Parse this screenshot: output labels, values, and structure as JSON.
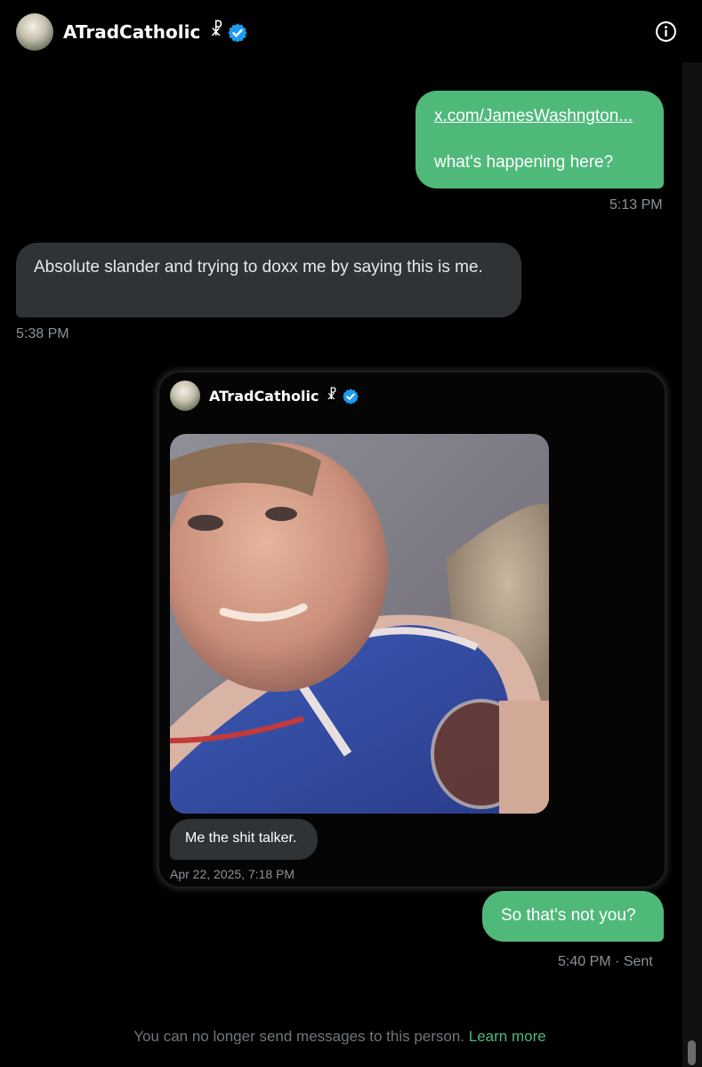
{
  "header": {
    "name": "ATradCatholic",
    "cross_symbol": "☧",
    "verified_icon": "verified-badge-icon",
    "info_icon": "info-icon"
  },
  "messages": {
    "m1": {
      "link": "x.com/JamesWashngton...",
      "text": "what's happening here?",
      "time": "5:13 PM"
    },
    "m2": {
      "text": "Absolute slander and trying to doxx me by saying this is me.",
      "time": "5:38 PM"
    },
    "shared": {
      "name": "ATradCatholic",
      "cross_symbol": "☧",
      "caption": "Me the shit talker.",
      "date": "Apr 22, 2025, 7:18 PM"
    },
    "m3": {
      "text": "So that's not you?",
      "time": "5:40 PM",
      "separator": "·",
      "status": "Sent"
    }
  },
  "footer": {
    "text": "You can no longer send messages to this person.",
    "link": "Learn more"
  },
  "colors": {
    "background": "#000000",
    "outgoing_bubble": "#4fb97a",
    "incoming_bubble": "#2f3336",
    "verified": "#1d9bf0",
    "muted_text": "#71767b"
  }
}
